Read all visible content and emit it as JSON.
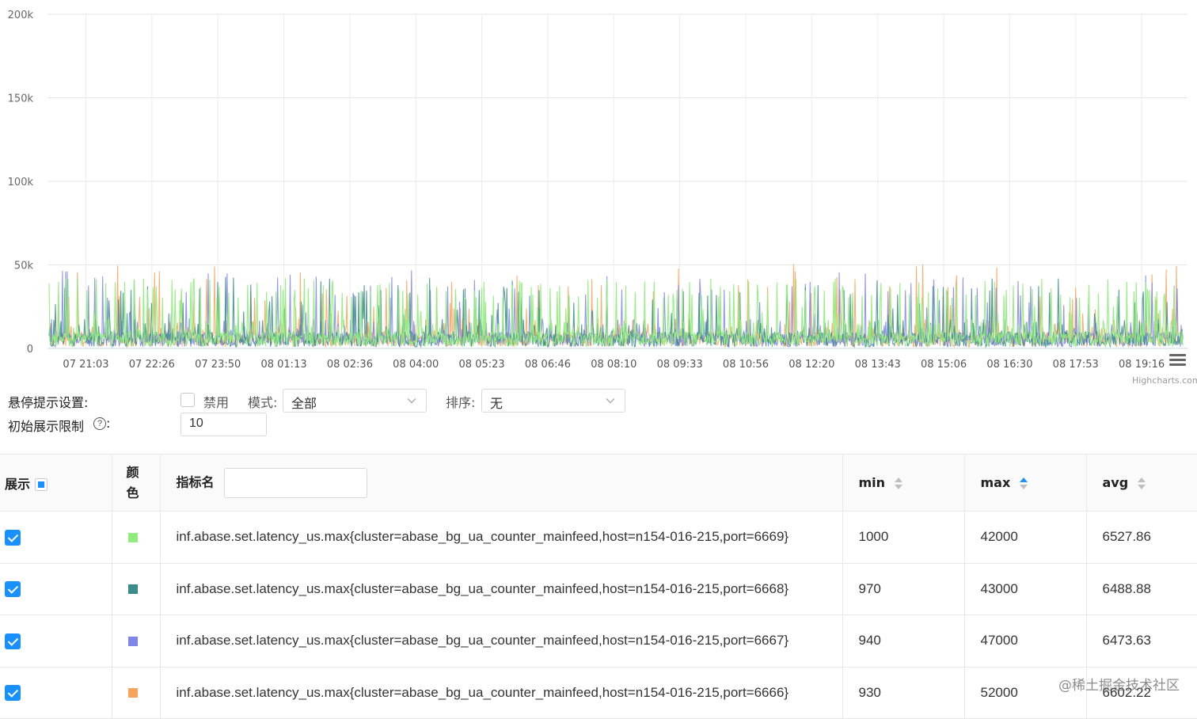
{
  "chart_data": {
    "type": "line",
    "y_ticks": [
      "200k",
      "150k",
      "100k",
      "50k",
      "0"
    ],
    "x_ticks": [
      "07 21:03",
      "07 22:26",
      "07 23:50",
      "08 01:13",
      "08 02:36",
      "08 04:00",
      "08 05:23",
      "08 06:46",
      "08 08:10",
      "08 09:33",
      "08 10:56",
      "08 12:20",
      "08 13:43",
      "08 15:06",
      "08 16:30",
      "08 17:53",
      "08 19:16"
    ],
    "ylim": [
      0,
      200000
    ],
    "grid": true,
    "credit": "Highcharts.com",
    "series": [
      {
        "color": "#90ed7d",
        "min": 1000,
        "max": 42000,
        "avg": 6527.86
      },
      {
        "color": "#3d8a8a",
        "min": 970,
        "max": 43000,
        "avg": 6488.88
      },
      {
        "color": "#8085e9",
        "min": 940,
        "max": 47000,
        "avg": 6473.63
      },
      {
        "color": "#f7a35c",
        "min": 930,
        "max": 52000,
        "avg": 6602.22
      }
    ]
  },
  "controls": {
    "hover_settings_label": "悬停提示设置:",
    "disable_label": "禁用",
    "mode_label": "模式:",
    "mode_value": "全部",
    "sort_label": "排序:",
    "sort_value": "无",
    "init_limit_label": "初始展示限制",
    "help_glyph": "?",
    "colon": ":",
    "init_limit_value": "10"
  },
  "table": {
    "headers": {
      "show": "展示",
      "color_top": "颜",
      "color_bottom": "色",
      "name": "指标名",
      "min": "min",
      "max": "max",
      "avg": "avg"
    },
    "rows": [
      {
        "color": "#90ed7d",
        "name": "inf.abase.set.latency_us.max{cluster=abase_bg_ua_counter_mainfeed,host=n154-016-215,port=6669}",
        "min": "1000",
        "max": "42000",
        "avg": "6527.86"
      },
      {
        "color": "#3d8a8a",
        "name": "inf.abase.set.latency_us.max{cluster=abase_bg_ua_counter_mainfeed,host=n154-016-215,port=6668}",
        "min": "970",
        "max": "43000",
        "avg": "6488.88"
      },
      {
        "color": "#8085e9",
        "name": "inf.abase.set.latency_us.max{cluster=abase_bg_ua_counter_mainfeed,host=n154-016-215,port=6667}",
        "min": "940",
        "max": "47000",
        "avg": "6473.63"
      },
      {
        "color": "#f7a35c",
        "name": "inf.abase.set.latency_us.max{cluster=abase_bg_ua_counter_mainfeed,host=n154-016-215,port=6666}",
        "min": "930",
        "max": "52000",
        "avg": "6602.22"
      }
    ]
  },
  "watermark": "@稀土掘金技术社区"
}
